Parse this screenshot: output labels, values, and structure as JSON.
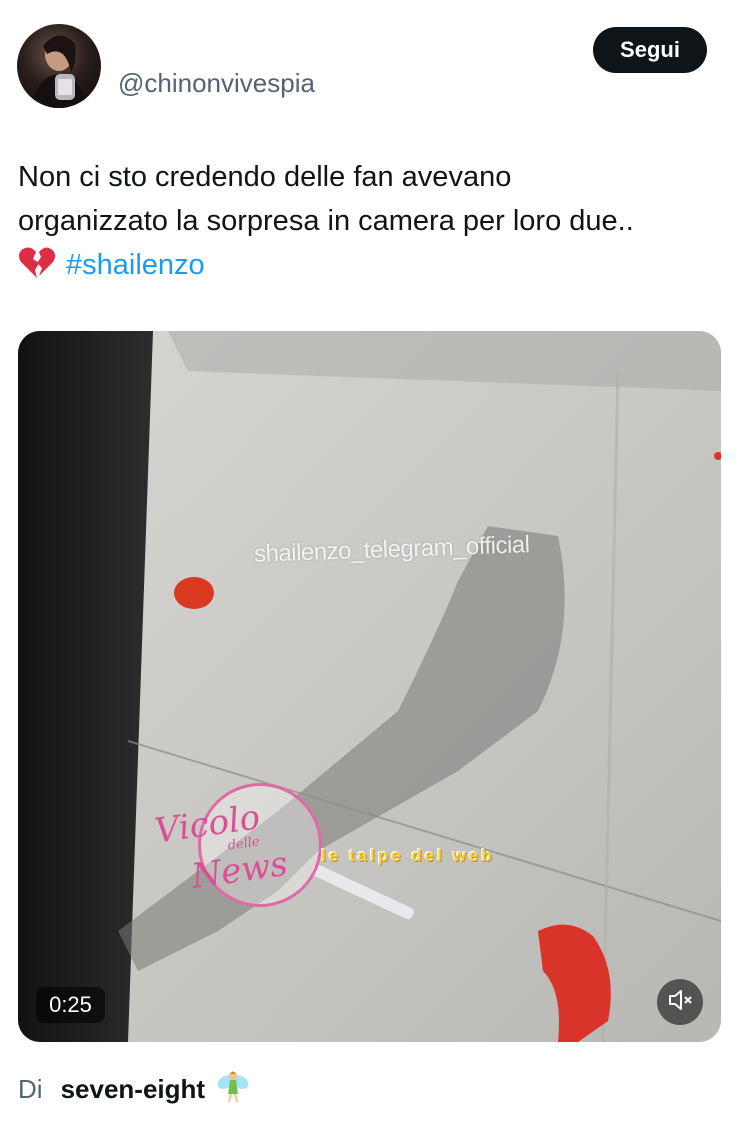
{
  "post": {
    "handle": "@chinonvivespia",
    "follow_label": "Segui",
    "text_line1": "Non ci sto credendo delle fan avevano",
    "text_line2": "organizzato la sorpresa in camera per loro due..",
    "hashtag": "#shailenzo",
    "emoji_icon": "broken-heart-icon"
  },
  "video": {
    "overlay_text": "shailenzo_telegram_official",
    "logo_script": "Vicolo",
    "logo_small": "delle",
    "logo_script2": "News",
    "logo_talpe": "le talpe del web",
    "duration": "0:25",
    "mute_icon": "speaker-muted-icon"
  },
  "byline": {
    "prefix": "Di",
    "author": "seven-eight",
    "emoji_icon": "fairy-icon"
  },
  "colors": {
    "accent": "#1d9bf0",
    "button_bg": "#0f1419",
    "secondary_text": "#536471"
  }
}
